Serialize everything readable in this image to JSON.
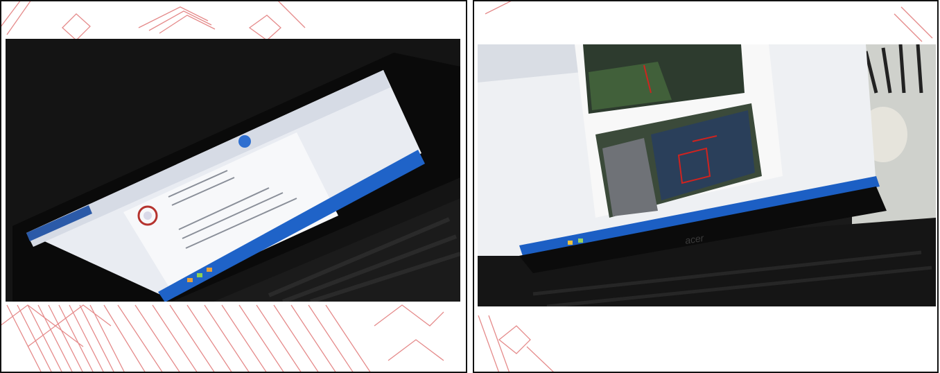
{
  "panels": [
    {
      "id": "left",
      "subject": "laptop-with-word-document",
      "colors": {
        "screen": "#e9ecf2",
        "taskbar": "#1f63c8",
        "ribbon": "#2b5aa8",
        "seal": "#b5332e",
        "logo": "#2f6fd0"
      }
    },
    {
      "id": "right",
      "subject": "acer-laptop-with-site-photos-document",
      "brand_text": "acer",
      "colors": {
        "screen": "#eef0f3",
        "taskbar": "#1c5fc4",
        "foliage": "#3f6b3a",
        "markup": "#d0231f"
      }
    }
  ],
  "background": {
    "pattern": "red-outline-building-map",
    "color": "#e06a6a"
  },
  "frame_color": "#111111"
}
